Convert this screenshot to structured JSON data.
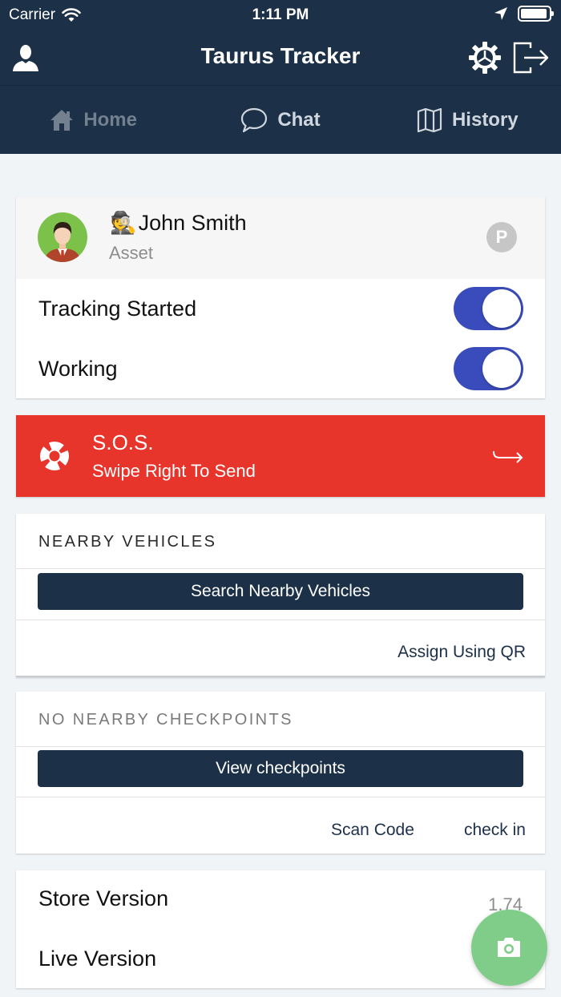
{
  "status_bar": {
    "carrier": "Carrier",
    "time": "1:11 PM"
  },
  "header": {
    "title": "Taurus Tracker"
  },
  "tabs": [
    {
      "label": "Home",
      "icon": "home-icon"
    },
    {
      "label": "Chat",
      "icon": "chat-icon"
    },
    {
      "label": "History",
      "icon": "map-icon"
    }
  ],
  "profile": {
    "name": "John Smith",
    "name_emoji": "🕵",
    "role": "Asset",
    "badge": "P",
    "toggles": [
      {
        "label": "Tracking Started",
        "on": true
      },
      {
        "label": "Working",
        "on": true
      }
    ]
  },
  "sos": {
    "title": "S.O.S.",
    "subtitle": "Swipe Right To Send"
  },
  "nearby_vehicles": {
    "heading": "NEARBY VEHICLES",
    "button": "Search Nearby Vehicles",
    "link": "Assign Using QR"
  },
  "checkpoints": {
    "heading": "NO NEARBY CHECKPOINTS",
    "button": "View checkpoints",
    "links": [
      "Scan Code",
      "check in"
    ]
  },
  "versions": {
    "store_label": "Store Version",
    "store_value": "1.74",
    "live_label": "Live Version"
  },
  "colors": {
    "header": "#1c3047",
    "toggle_on": "#3a4cbb",
    "sos": "#e8352c",
    "fab": "#80cd89"
  }
}
